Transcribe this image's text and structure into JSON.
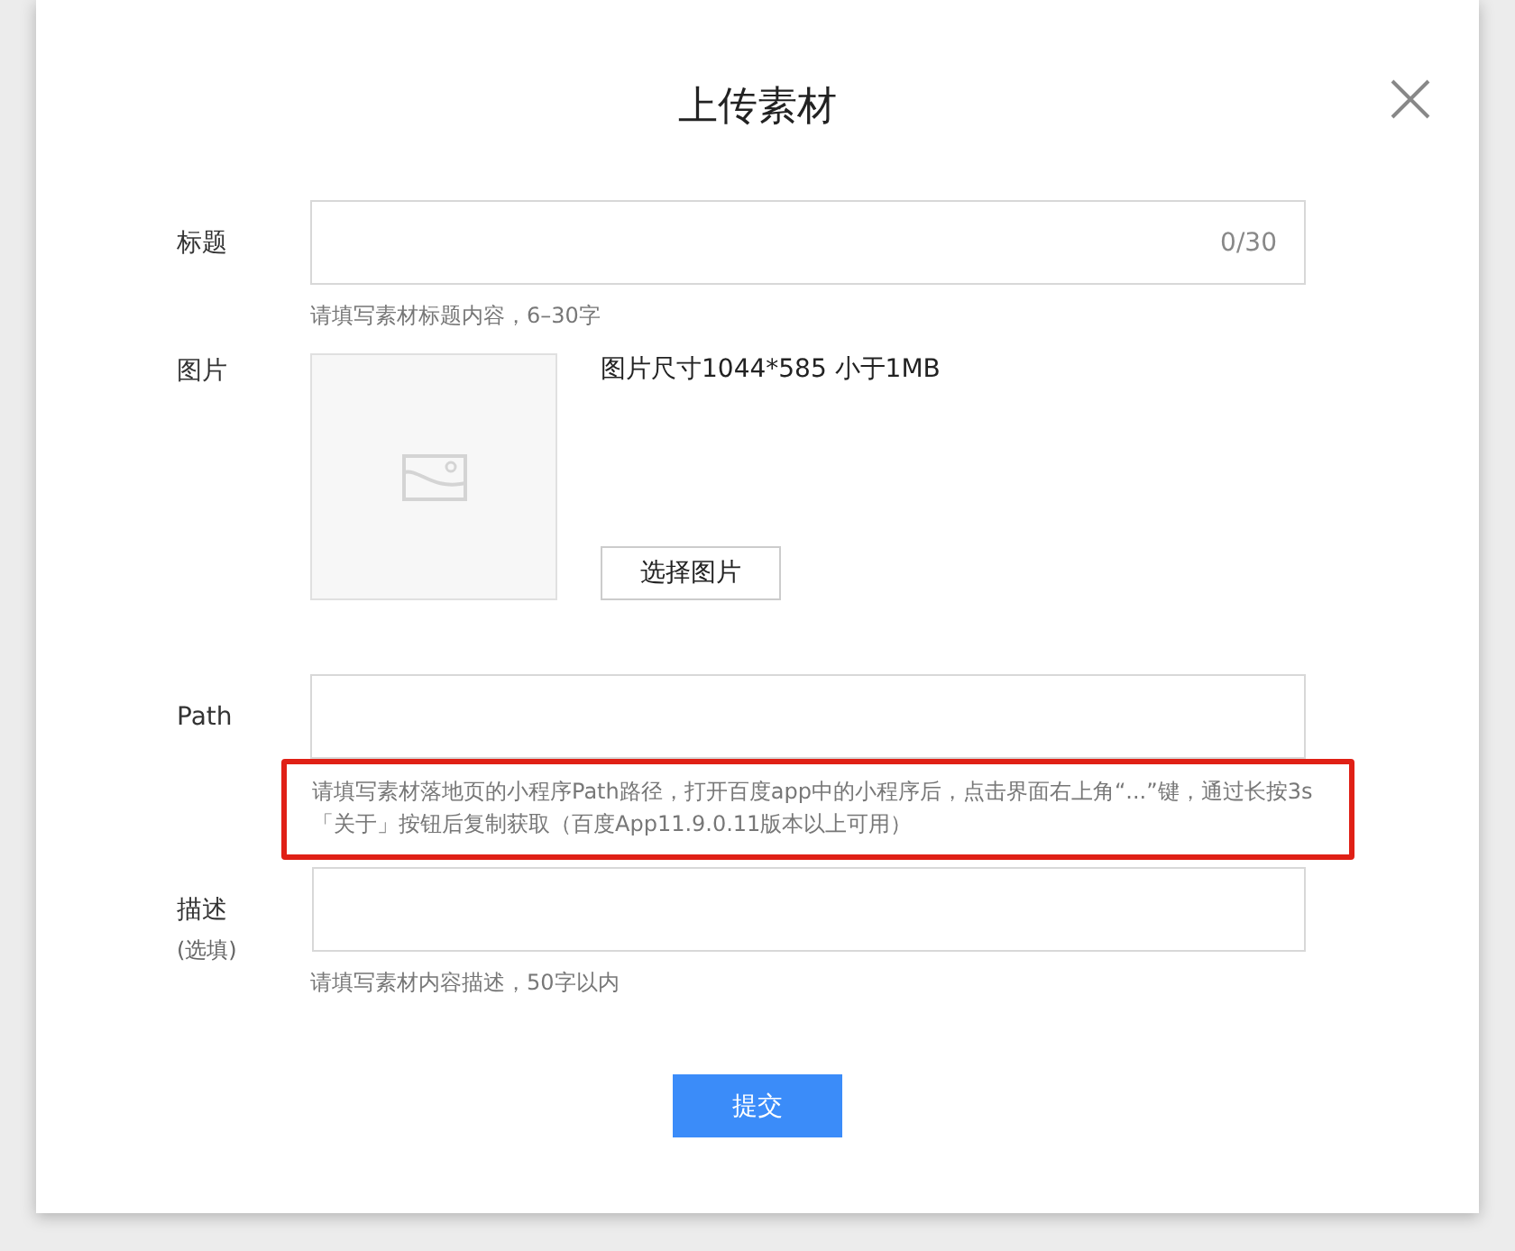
{
  "dialog": {
    "title": "上传素材"
  },
  "fields": [
    {
      "kind": "text",
      "label": "标题",
      "counter": "0/30",
      "hint": "请填写素材标题内容，6–30字",
      "highlighted": false
    },
    {
      "kind": "image",
      "label": "图片",
      "size_note": "图片尺寸1044*585 小于1MB",
      "button": "选择图片"
    },
    {
      "kind": "text",
      "label": "Path",
      "hint": "请填写素材落地页的小程序Path路径，打开百度app中的小程序后，点击界面右上角“...”键，通过长按3s「关于」按钮后复制获取（百度App11.9.0.11版本以上可用）",
      "highlighted": true
    },
    {
      "kind": "text",
      "label": "描述",
      "sublabel": "(选填)",
      "hint": "请填写素材内容描述，50字以内",
      "highlighted": false
    }
  ],
  "submit": "提交"
}
